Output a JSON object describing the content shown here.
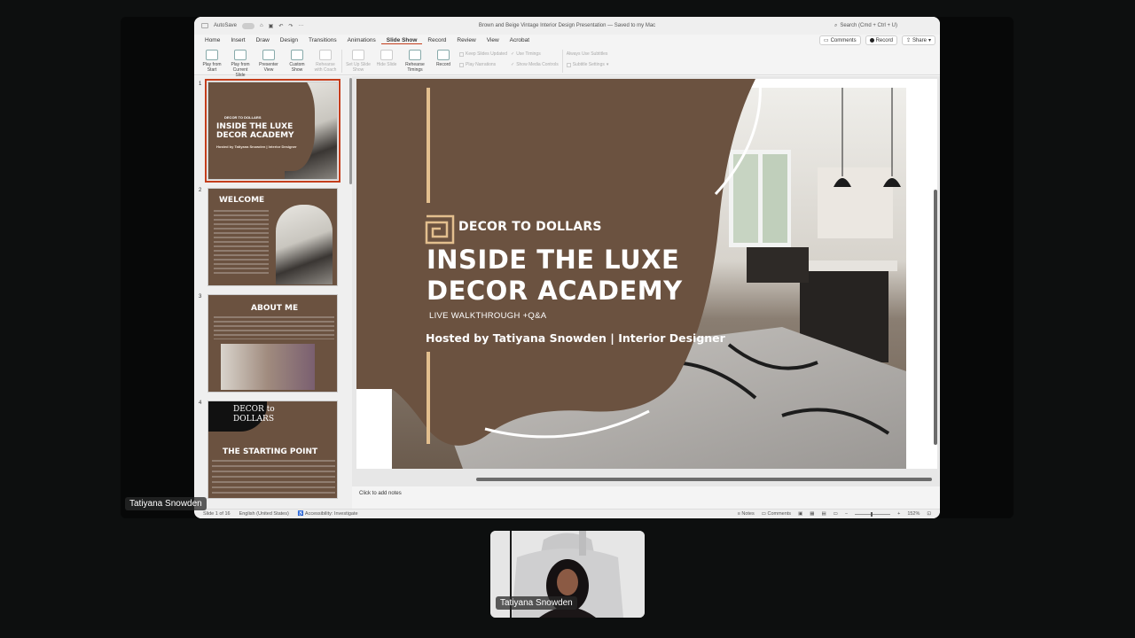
{
  "app": {
    "document_title": "Brown and Beige Vintage Interior Design Presentation — Saved to my Mac",
    "autosave_label": "AutoSave",
    "search_placeholder": "Search (Cmd + Ctrl + U)"
  },
  "ribbon": {
    "tabs": [
      "Home",
      "Insert",
      "Draw",
      "Design",
      "Transitions",
      "Animations",
      "Slide Show",
      "Record",
      "Review",
      "View",
      "Acrobat"
    ],
    "active_tab": "Slide Show",
    "comments_label": "Comments",
    "record_label": "Record",
    "share_label": "Share",
    "tools": [
      {
        "label": "Play from Start"
      },
      {
        "label": "Play from Current Slide"
      },
      {
        "label": "Presenter View"
      },
      {
        "label": "Custom Show"
      },
      {
        "label": "Rehearse with Coach"
      },
      {
        "label": "Set Up Slide Show"
      },
      {
        "label": "Hide Slide"
      },
      {
        "label": "Rehearse Timings"
      },
      {
        "label": "Record"
      }
    ],
    "options": {
      "keep_updated": "Keep Slides Updated",
      "play_narrations": "Play Narrations",
      "use_timings": "Use Timings",
      "show_media_controls": "Show Media Controls",
      "always_use_subtitles": "Always Use Subtitles",
      "subtitle_settings": "Subtitle Settings"
    }
  },
  "thumbnails": [
    {
      "number": "1",
      "title": "INSIDE THE LUXE DECOR ACADEMY",
      "brand": "DECOR TO DOLLARS",
      "subtitle": "Hosted by Tatiyana Snowden | Interior Designer"
    },
    {
      "number": "2",
      "title": "WELCOME"
    },
    {
      "number": "3",
      "title": "ABOUT ME"
    },
    {
      "number": "4",
      "title": "THE STARTING POINT",
      "logo_line1": "DECOR to",
      "logo_line2": "DOLLARS"
    }
  ],
  "slide": {
    "brand": "DECOR TO DOLLARS",
    "title_line1": "INSIDE THE LUXE",
    "title_line2": "DECOR ACADEMY",
    "tagline": "LIVE WALKTHROUGH +Q&A",
    "host": "Hosted by Tatiyana Snowden | Interior Designer",
    "colors": {
      "brown": "#6b5240",
      "accent": "#e3bf8e"
    }
  },
  "notes_placeholder": "Click to add notes",
  "status": {
    "slide_counter": "Slide 1 of 16",
    "language": "English (United States)",
    "accessibility": "Accessibility: Investigate",
    "notes": "Notes",
    "comments": "Comments",
    "zoom": "152%"
  },
  "participants": {
    "main_name": "Tatiyana Snowden",
    "camera_name": "Tatiyana Snowden"
  }
}
